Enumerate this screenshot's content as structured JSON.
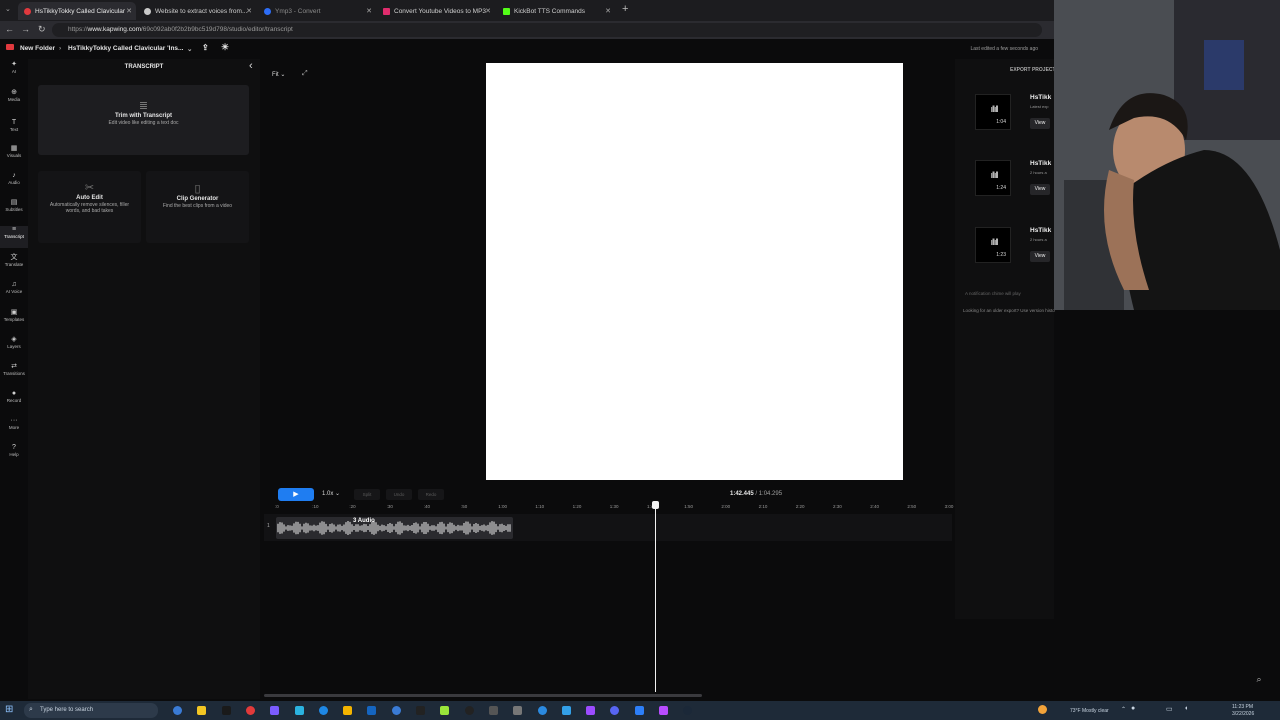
{
  "browser": {
    "tabs": [
      {
        "title": "HsTikkyTokky Called Clavicular 'In...",
        "active": true,
        "fav_color": "#e0393e"
      },
      {
        "title": "Website to extract voices from...",
        "active": false,
        "fav_color": "#c9c9c9"
      },
      {
        "title": "Ymp3 - Convert",
        "active": false,
        "fav_color": "#2d6df6"
      },
      {
        "title": "Convert Youtube Videos to MP3 fi...",
        "active": false,
        "fav_color": "#e02c6d"
      },
      {
        "title": "KickBot TTS Commands",
        "active": false,
        "fav_color": "#53fc18"
      }
    ],
    "new_tab": "+",
    "url_prefix": "https://",
    "url_host": "www.kapwing.com",
    "url_path": "/69c092ab0f2b2b9bc519d798/studio/editor/transcript"
  },
  "header": {
    "folder": "New Folder",
    "separator": "›",
    "project_title": "HsTikkyTokky Called Clavicular 'Ins...",
    "edited": "Last edited a few seconds ago"
  },
  "rail": [
    {
      "icon": "✦",
      "label": "AI",
      "icon_name": "ai-icon"
    },
    {
      "icon": "⊕",
      "label": "Media",
      "icon_name": "media-icon"
    },
    {
      "icon": "T",
      "label": "Text",
      "icon_name": "text-icon"
    },
    {
      "icon": "▦",
      "label": "Visuals",
      "icon_name": "visuals-icon"
    },
    {
      "icon": "♪",
      "label": "Audio",
      "icon_name": "audio-icon"
    },
    {
      "icon": "▤",
      "label": "Subtitles",
      "icon_name": "subtitles-icon"
    },
    {
      "icon": "≡",
      "label": "Transcript",
      "icon_name": "transcript-icon",
      "selected": true
    },
    {
      "icon": "文",
      "label": "Translate",
      "icon_name": "translate-icon"
    },
    {
      "icon": "♫",
      "label": "AI Voice",
      "icon_name": "ai-voice-icon"
    },
    {
      "icon": "▣",
      "label": "Templates",
      "icon_name": "templates-icon"
    },
    {
      "icon": "◈",
      "label": "Layers",
      "icon_name": "layers-icon"
    },
    {
      "icon": "⇄",
      "label": "Transitions",
      "icon_name": "transitions-icon"
    },
    {
      "icon": "●",
      "label": "Record",
      "icon_name": "record-icon"
    },
    {
      "icon": "···",
      "label": "More",
      "icon_name": "more-icon"
    },
    {
      "icon": "?",
      "label": "Help",
      "icon_name": "help-icon"
    }
  ],
  "panel": {
    "title": "TRANSCRIPT",
    "collapse": "‹",
    "trim_card": {
      "title": "Trim with Transcript",
      "subtitle": "Edit video like editing a text doc"
    },
    "auto_edit_card": {
      "title": "Auto Edit",
      "subtitle": "Automatically remove silences, filler words, and bad takes"
    },
    "clip_card": {
      "title": "Clip Generator",
      "subtitle": "Find the best clips from a video"
    }
  },
  "editor": {
    "fit_label": "Fit",
    "fit_caret": "⌄"
  },
  "export": {
    "title": "EXPORT PROJECT",
    "items": [
      {
        "name": "HsTikk",
        "sub": "Latest exp",
        "duration": "1:04",
        "view": "View"
      },
      {
        "name": "HsTikk",
        "sub": "2 hours a",
        "duration": "1:24",
        "view": "View"
      },
      {
        "name": "HsTikk",
        "sub": "2 hours a",
        "duration": "1:23",
        "view": "View"
      }
    ],
    "notice1": "A notification chime will play",
    "notice2": "Looking for an older export? Use version history to find exports of previous projects here"
  },
  "timeline": {
    "play": "▶",
    "speed": "1.0x",
    "buttons": [
      "Split",
      "Undo",
      "Redo"
    ],
    "current": "1:42.445",
    "total": "/ 1:04.295",
    "ticks": [
      ":0",
      ":10",
      ":20",
      ":30",
      ":40",
      ":50",
      "1:00",
      "1:10",
      "1:20",
      "1:30",
      "1:40",
      "1:50",
      "2:00",
      "2:10",
      "2:20",
      "2:30",
      "2:40",
      "2:50",
      "3:00"
    ],
    "track_number": "1",
    "clip_label": "3 Audio",
    "clip_color": "#2a2a2e"
  },
  "taskbar": {
    "search_placeholder": "Type here to search",
    "weather": "73°F  Mostly clear",
    "time": "11:23 PM",
    "date": "3/22/2026"
  },
  "colors": {
    "accent": "#1f7df1",
    "canvas": "#ffffff",
    "background": "#0b0b0c"
  }
}
